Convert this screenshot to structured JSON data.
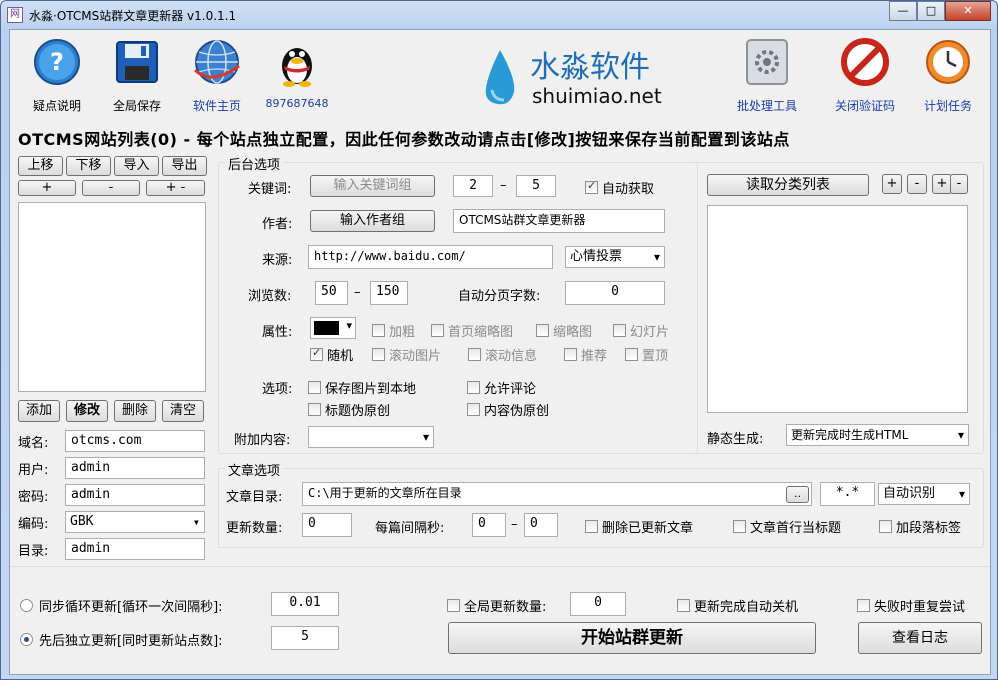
{
  "window": {
    "title": "水淼·OTCMS站群文章更新器 v1.0.1.1",
    "app_icon": "网",
    "min": "—",
    "max": "□",
    "close": "✕"
  },
  "toolbar": {
    "items": [
      {
        "label": "疑点说明",
        "icon": "help-icon"
      },
      {
        "label": "全局保存",
        "icon": "save-icon"
      },
      {
        "label": "软件主页",
        "icon": "globe-icon"
      },
      {
        "label": "897687648",
        "icon": "qq-penguin-icon"
      }
    ],
    "right_items": [
      {
        "label": "批处理工具",
        "icon": "batch-tools-icon"
      },
      {
        "label": "关闭验证码",
        "icon": "forbidden-icon"
      },
      {
        "label": "计划任务",
        "icon": "clock-icon"
      }
    ],
    "brand": {
      "name": "水淼软件",
      "url": "shuimiao.net"
    }
  },
  "heading": "OTCMS网站列表(0) - 每个站点独立配置，因此任何参数改动请点击[修改]按钮来保存当前配置到该站点",
  "site_list": {
    "buttons": [
      "上移",
      "下移",
      "导入",
      "导出"
    ],
    "small_buttons": [
      "+",
      "-",
      "+ -"
    ],
    "actions": [
      "添加",
      "修改",
      "删除",
      "清空"
    ],
    "fields": [
      {
        "label": "域名:",
        "value": "otcms.com"
      },
      {
        "label": "用户:",
        "value": "admin"
      },
      {
        "label": "密码:",
        "value": "admin"
      },
      {
        "label": "编码:",
        "value": "GBK"
      },
      {
        "label": "目录:",
        "value": "admin"
      }
    ]
  },
  "backend": {
    "title": "后台选项",
    "keyword_label": "关键词:",
    "keyword_btn": "输入关键词组",
    "keyword_min": "2",
    "keyword_max": "5",
    "auto_get": "自动获取",
    "author_label": "作者:",
    "author_btn": "输入作者组",
    "author_value": "OTCMS站群文章更新器",
    "source_label": "来源:",
    "source_value": "http://www.baidu.com/",
    "source_select": "心情投票",
    "views_label": "浏览数:",
    "views_min": "50",
    "views_max": "150",
    "dash": "–",
    "auto_page_label": "自动分页字数:",
    "auto_page_value": "0",
    "attr_label": "属性:",
    "attrs_row1": [
      "加粗",
      "首页缩略图",
      "缩略图",
      "幻灯片"
    ],
    "attrs_row2": [
      "随机",
      "滚动图片",
      "滚动信息",
      "推荐",
      "置顶"
    ],
    "options_label": "选项:",
    "options": [
      "保存图片到本地",
      "允许评论",
      "标题伪原创",
      "内容伪原创"
    ],
    "extra_label": "附加内容:",
    "extra_value": ""
  },
  "category": {
    "read_btn": "读取分类列表",
    "small_buttons": [
      "+",
      "-",
      "+",
      "-"
    ],
    "static_label": "静态生成:",
    "static_value": "更新完成时生成HTML"
  },
  "article": {
    "title": "文章选项",
    "dir_label": "文章目录:",
    "dir_value": "C:\\用于更新的文章所在目录",
    "browse": "..",
    "ext": "*.*",
    "encoding": "自动识别",
    "count_label": "更新数量:",
    "count_value": "0",
    "interval_label": "每篇间隔秒:",
    "interval_min": "0",
    "interval_max": "0",
    "delete_updated": "删除已更新文章",
    "first_line_title": "文章首行当标题",
    "para_tags": "加段落标签"
  },
  "bottom": {
    "sync_label": "同步循环更新[循环一次间隔秒]:",
    "sync_value": "0.01",
    "seq_label": "先后独立更新[同时更新站点数]:",
    "seq_value": "5",
    "global_count_label": "全局更新数量:",
    "global_count_value": "0",
    "shutdown": "更新完成自动关机",
    "retry": "失败时重复尝试",
    "start_btn": "开始站群更新",
    "log_btn": "查看日志"
  }
}
